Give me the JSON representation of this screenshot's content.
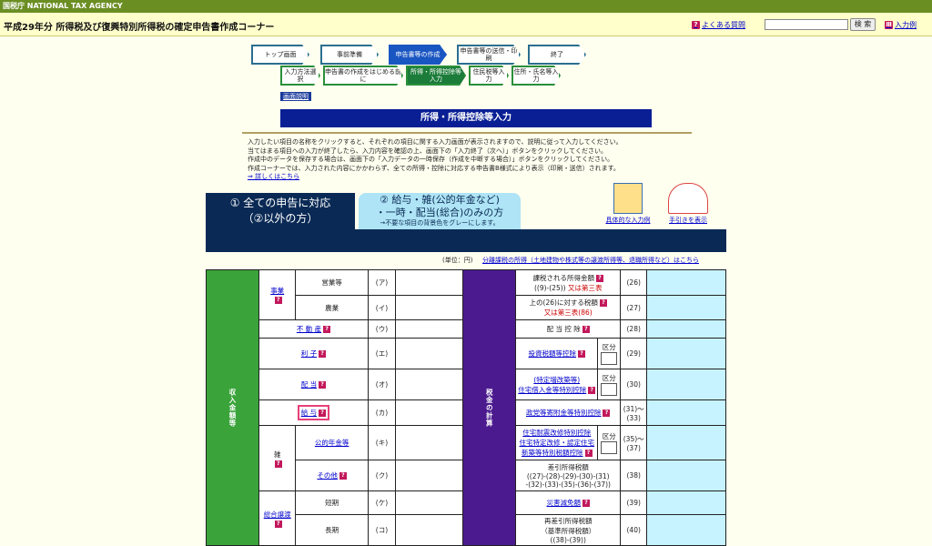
{
  "top_bar": "国税庁 NATIONAL TAX AGENCY",
  "header": {
    "title": "平成29年分 所得税及び復興特別所得税の確定申告書作成コーナー",
    "faq": "よくある質問",
    "search_button": "検 索",
    "input_example": "入力例"
  },
  "steps": [
    {
      "label": "トップ画面"
    },
    {
      "label": "事前準備"
    },
    {
      "label": "申告書等の作成"
    },
    {
      "label": "申告書等の送信・印刷"
    },
    {
      "label": "終了"
    }
  ],
  "substeps": [
    {
      "label": "入力方法選択"
    },
    {
      "label": "申告書の作成をはじめる前に"
    },
    {
      "label": "所得・所得控除等入力"
    },
    {
      "label": "住民税等入力"
    },
    {
      "label": "住所・氏名等入力"
    }
  ],
  "help_button": "画面説明",
  "banner": "所得・所得控除等入力",
  "intro": {
    "line1": "入力したい項目の名称をクリックすると、それぞれの項目に関する入力画面が表示されますので、説明に従って入力してください。",
    "line2": "当てはまる項目への入力が終了したら、入力内容を確認の上、画面下の「入力終了（次へ）」ボタンをクリックしてください。",
    "line3": "作成中のデータを保存する場合は、画面下の「入力データの一時保存（作成を中断する場合）」ボタンをクリックしてください。",
    "line4": "作成コーナーでは、入力された内容にかかわらず、全ての所得・控除に対応する申告書B様式により表示（印刷・送信）されます。",
    "link": "⇒ 詳しくはこちら"
  },
  "tab1": {
    "line1": "① 全ての申告に対応",
    "line2": "（②以外の方）"
  },
  "tab2": {
    "line1": "② 給与・雑(公的年金など)",
    "line2": "・一時・配当(総合)のみの方",
    "line3": "→不要な項目の背景色をグレーにします。"
  },
  "right_buttons": {
    "example": "具体的な入力例",
    "guide": "手引きを表示"
  },
  "unit": "(単位：円)",
  "unit_link": "分離課税の所得（土地建物や株式等の譲渡所得等、退職所得など）はこちら",
  "left_band": "収入金額等",
  "right_band": "税金の計算",
  "kubun": "区分",
  "rows": {
    "jigyo": "事業",
    "eigyo": "営業等",
    "nogyo": "農業",
    "fudosan": "不 動 産",
    "rishi": "利 子",
    "haito": "配 当",
    "kyuyo": "給 与",
    "zatsu": "雑",
    "koteki": "公的年金等",
    "sonota": "その他",
    "sogo": "総合譲渡",
    "tanki": "短期",
    "choki": "長期",
    "codes": [
      "(ア)",
      "(イ)",
      "(ウ)",
      "(エ)",
      "(オ)",
      "(カ)",
      "(キ)",
      "(ク)",
      "(ケ)",
      "(コ)"
    ]
  },
  "tax": {
    "r26a": "課税される所得金額",
    "r26b": "((9)-(25))",
    "r26c": "又は第三表",
    "r27a": "上の(26)に対する税額",
    "r27b": "又は第三表(86)",
    "r28": "配 当 控 除",
    "r29": "投資税額等控除",
    "r30a": "(特定増改築等)",
    "r30b": "住宅借入金等特別控除",
    "r31": "政党等寄附金等特別控除",
    "r35a": "住宅耐震改修特別控除",
    "r35b": "住宅特定改修・認定住宅",
    "r35c": "新築等特別税額控除",
    "r38a": "差引所得税額",
    "r38b": "((27)-(28)-(29)-(30)-(31)",
    "r38c": "-(32)-(33)-(35)-(36)-(37))",
    "r39": "災害減免額",
    "r40a": "再差引所得税額",
    "r40b": "（基準所得税額）",
    "r40c": "((38)-(39))",
    "n26": "(26)",
    "n27": "(27)",
    "n28": "(28)",
    "n29": "(29)",
    "n30": "(30)",
    "n31": "(31)～(33)",
    "n35": "(35)～(37)",
    "n38": "(38)",
    "n39": "(39)",
    "n40": "(40)"
  }
}
